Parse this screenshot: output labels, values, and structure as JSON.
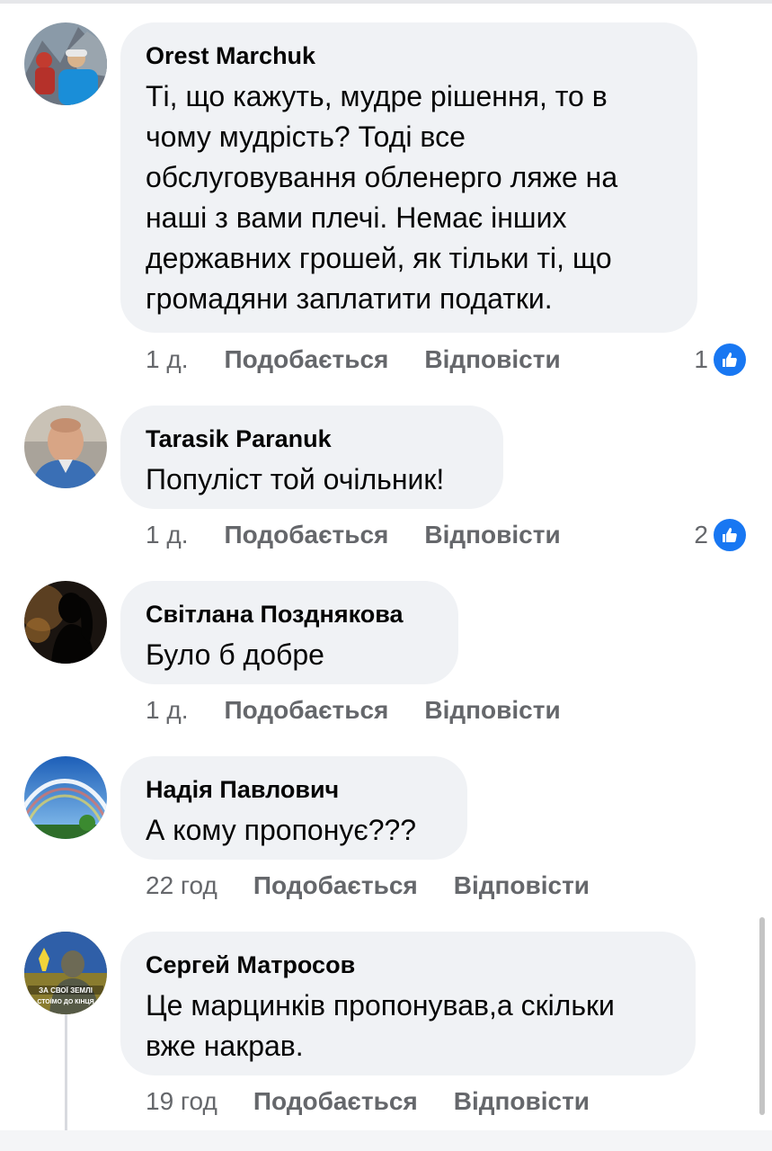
{
  "comments": [
    {
      "author": "Orest Marchuk",
      "text": "Ті, що кажуть, мудре рішення, то в чому мудрість? Тоді все обслуговування обленерго ляже на наші з вами плечі. Немає інших державних  грошей, як тільки ті, що громадяни заплатити податки.",
      "time": "1 д.",
      "like_label": "Подобається",
      "reply_label": "Відповісти",
      "reactions": "1",
      "avatar_icon": "climber-photo"
    },
    {
      "author": "Tarasik Paranuk",
      "text": "Популіст той очільник!",
      "time": "1 д.",
      "like_label": "Подобається",
      "reply_label": "Відповісти",
      "reactions": "2",
      "avatar_icon": "man-portrait-photo"
    },
    {
      "author": "Світлана Позднякова",
      "text": "Було б добре",
      "time": "1 д.",
      "like_label": "Подобається",
      "reply_label": "Відповісти",
      "avatar_icon": "silhouette-photo"
    },
    {
      "author": "Надія Павлович",
      "text": "А кому пропонує???",
      "time": "22 год",
      "like_label": "Подобається",
      "reply_label": "Відповісти",
      "avatar_icon": "rainbow-sky-photo"
    },
    {
      "author": "Сергей Матросов",
      "text": "Це марцинків пропонував,а скільки вже накрав.",
      "time": "19 год",
      "like_label": "Подобається",
      "reply_label": "Відповісти",
      "avatar_icon": "soldier-flag-photo",
      "avatar_text_line1": "ЗА СВОЇ ЗЕМЛІ",
      "avatar_text_line2": "СТОЇМО ДО КІНЦЯ"
    }
  ],
  "colors": {
    "bubble": "#f0f2f5",
    "meta": "#65676b",
    "like_blue": "#1877f2"
  }
}
